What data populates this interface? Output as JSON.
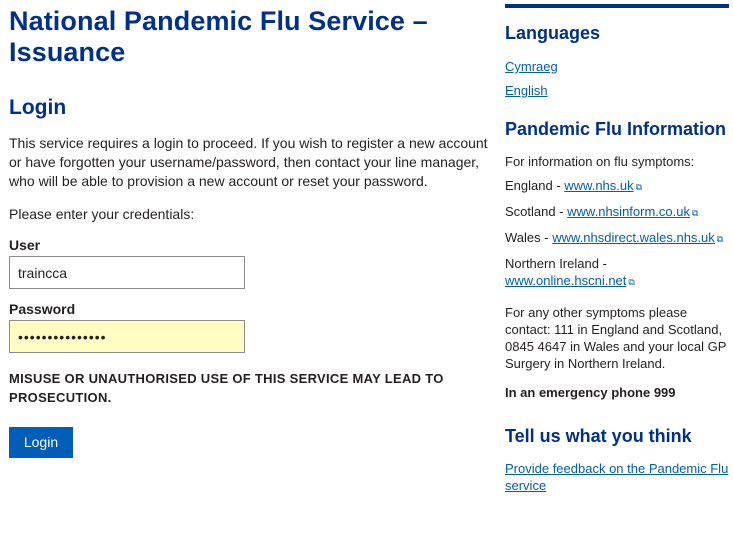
{
  "main": {
    "service_title": "National Pandemic Flu Service – Issuance",
    "login_heading": "Login",
    "intro": "This service requires a login to proceed. If you wish to register a new account or have forgotten your username/password, then contact your line manager, who will be able to provision a new account or reset your password.",
    "prompt": "Please enter your credentials:",
    "user_label": "User",
    "user_value": "traincca",
    "password_label": "Password",
    "password_mask": "•••••••••••••••",
    "warning": "MISUSE OR UNAUTHORISED USE OF THIS SERVICE MAY LEAD TO PROSECUTION.",
    "login_button": "Login"
  },
  "sidebar": {
    "languages_heading": "Languages",
    "languages": [
      "Cymraeg",
      "English"
    ],
    "pf_heading": "Pandemic Flu Information",
    "flu_intro": "For information on flu symptoms:",
    "regions": [
      {
        "name": "England - ",
        "link": "www.nhs.uk"
      },
      {
        "name": "Scotland - ",
        "link": "www.nhsinform.co.uk"
      },
      {
        "name": "Wales - ",
        "link": "www.nhsdirect.wales.nhs.uk"
      },
      {
        "name": "Northern Ireland - ",
        "link": "www.online.hscni.net"
      }
    ],
    "other_symptoms": "For any other symptoms please contact: 111 in England and Scotland, 0845 4647 in Wales and your local GP Surgery in Northern Ireland.",
    "emergency": "In an emergency phone 999",
    "tell_heading": "Tell us what you think",
    "feedback_link": "Provide feedback on the Pandemic Flu service"
  },
  "icons": {
    "external_link": "external-link-icon"
  },
  "colors": {
    "heading": "#003087",
    "link": "#005eb8",
    "button": "#005eb8",
    "autofill": "#fefec3"
  }
}
